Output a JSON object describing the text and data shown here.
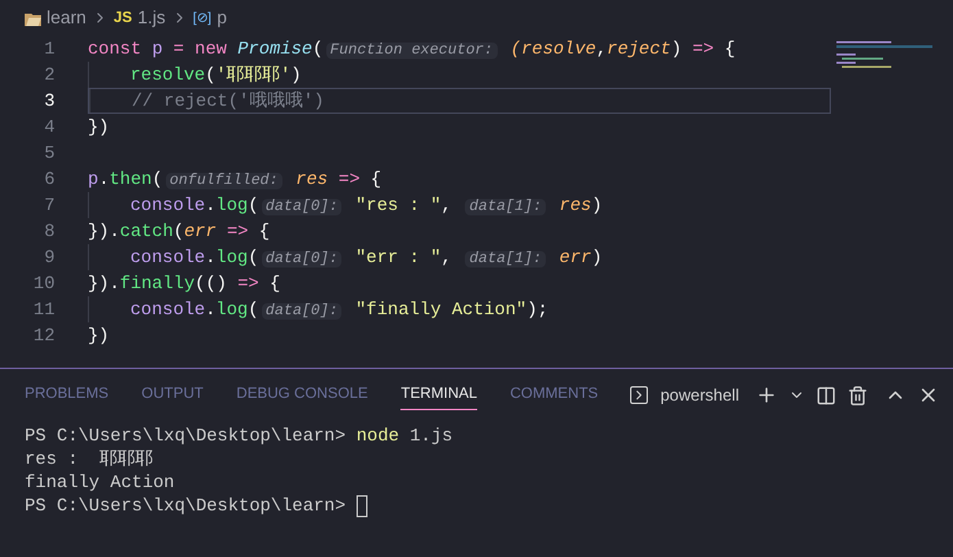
{
  "breadcrumb": [
    {
      "kind": "folder",
      "label": "learn"
    },
    {
      "kind": "js",
      "badge": "JS",
      "label": "1.js"
    },
    {
      "kind": "symbol",
      "badge": "[⊘]",
      "label": "p"
    }
  ],
  "code": [
    {
      "number": "1",
      "current": false,
      "indented": false,
      "tokens": [
        {
          "kind": "kw",
          "text": "const "
        },
        {
          "kind": "var",
          "text": "p "
        },
        {
          "kind": "op",
          "text": "= "
        },
        {
          "kind": "kw",
          "text": "new "
        },
        {
          "kind": "cls",
          "text": "Promise"
        },
        {
          "kind": "pn",
          "text": "("
        },
        {
          "kind": "hint",
          "text": "Function executor:"
        },
        {
          "kind": "par",
          "text": " (resolve"
        },
        {
          "kind": "pn",
          "text": ","
        },
        {
          "kind": "par",
          "text": "reject"
        },
        {
          "kind": "pn",
          "text": ") "
        },
        {
          "kind": "op",
          "text": "=> "
        },
        {
          "kind": "pn",
          "text": "{"
        }
      ]
    },
    {
      "number": "2",
      "current": false,
      "indented": true,
      "tokens": [
        {
          "kind": "fn",
          "text": "resolve"
        },
        {
          "kind": "pn",
          "text": "("
        },
        {
          "kind": "str",
          "text": "'耶耶耶'"
        },
        {
          "kind": "pn",
          "text": ")"
        }
      ]
    },
    {
      "number": "3",
      "current": true,
      "indented": true,
      "tokens": [
        {
          "kind": "cm",
          "text": "// reject('哦哦哦')"
        }
      ]
    },
    {
      "number": "4",
      "current": false,
      "indented": false,
      "tokens": [
        {
          "kind": "pn",
          "text": "})"
        }
      ]
    },
    {
      "number": "5",
      "current": false,
      "indented": false
    },
    {
      "number": "6",
      "current": false,
      "indented": false,
      "tokens": [
        {
          "kind": "var",
          "text": "p"
        },
        {
          "kind": "pn",
          "text": "."
        },
        {
          "kind": "fn",
          "text": "then"
        },
        {
          "kind": "pn",
          "text": "("
        },
        {
          "kind": "hint",
          "text": "onfulfilled:"
        },
        {
          "kind": "par",
          "text": " res "
        },
        {
          "kind": "op",
          "text": "=> "
        },
        {
          "kind": "pn",
          "text": "{"
        }
      ]
    },
    {
      "number": "7",
      "current": false,
      "indented": true,
      "tokens": [
        {
          "kind": "var",
          "text": "console"
        },
        {
          "kind": "pn",
          "text": "."
        },
        {
          "kind": "fn",
          "text": "log"
        },
        {
          "kind": "pn",
          "text": "("
        },
        {
          "kind": "hint",
          "text": "data[0]:"
        },
        {
          "kind": "str",
          "text": " \"res : \""
        },
        {
          "kind": "pn",
          "text": ", "
        },
        {
          "kind": "hint",
          "text": "data[1]:"
        },
        {
          "kind": "par",
          "text": " res"
        },
        {
          "kind": "pn",
          "text": ")"
        }
      ]
    },
    {
      "number": "8",
      "current": false,
      "indented": false,
      "tokens": [
        {
          "kind": "pn",
          "text": "})."
        },
        {
          "kind": "fn",
          "text": "catch"
        },
        {
          "kind": "pn",
          "text": "("
        },
        {
          "kind": "par",
          "text": "err "
        },
        {
          "kind": "op",
          "text": "=> "
        },
        {
          "kind": "pn",
          "text": "{"
        }
      ]
    },
    {
      "number": "9",
      "current": false,
      "indented": true,
      "tokens": [
        {
          "kind": "var",
          "text": "console"
        },
        {
          "kind": "pn",
          "text": "."
        },
        {
          "kind": "fn",
          "text": "log"
        },
        {
          "kind": "pn",
          "text": "("
        },
        {
          "kind": "hint",
          "text": "data[0]:"
        },
        {
          "kind": "str",
          "text": " \"err : \""
        },
        {
          "kind": "pn",
          "text": ", "
        },
        {
          "kind": "hint",
          "text": "data[1]:"
        },
        {
          "kind": "par",
          "text": " err"
        },
        {
          "kind": "pn",
          "text": ")"
        }
      ]
    },
    {
      "number": "10",
      "current": false,
      "indented": false,
      "tokens": [
        {
          "kind": "pn",
          "text": "})."
        },
        {
          "kind": "fn",
          "text": "finally"
        },
        {
          "kind": "pn",
          "text": "(() "
        },
        {
          "kind": "op",
          "text": "=> "
        },
        {
          "kind": "pn",
          "text": "{"
        }
      ]
    },
    {
      "number": "11",
      "current": false,
      "indented": true,
      "tokens": [
        {
          "kind": "var",
          "text": "console"
        },
        {
          "kind": "pn",
          "text": "."
        },
        {
          "kind": "fn",
          "text": "log"
        },
        {
          "kind": "pn",
          "text": "("
        },
        {
          "kind": "hint",
          "text": "data[0]:"
        },
        {
          "kind": "str",
          "text": " \"finally Action\""
        },
        {
          "kind": "pn",
          "text": ");"
        }
      ]
    },
    {
      "number": "12",
      "current": false,
      "indented": false,
      "tokens": [
        {
          "kind": "pn",
          "text": "})"
        }
      ]
    }
  ],
  "panel_tabs": [
    {
      "label": "PROBLEMS",
      "selected": false
    },
    {
      "label": "OUTPUT",
      "selected": false
    },
    {
      "label": "DEBUG CONSOLE",
      "selected": false
    },
    {
      "label": "TERMINAL",
      "selected": true
    },
    {
      "label": "COMMENTS",
      "selected": false
    }
  ],
  "terminal_name": "powershell",
  "terminal": [
    {
      "kind": "command",
      "prompt": "PS C:\\Users\\lxq\\Desktop\\learn> ",
      "command": "node",
      "args": " 1.js"
    },
    {
      "kind": "output",
      "text": "res :  耶耶耶"
    },
    {
      "kind": "output",
      "text": "finally Action"
    },
    {
      "kind": "prompt",
      "prompt": "PS C:\\Users\\lxq\\Desktop\\learn> "
    }
  ]
}
